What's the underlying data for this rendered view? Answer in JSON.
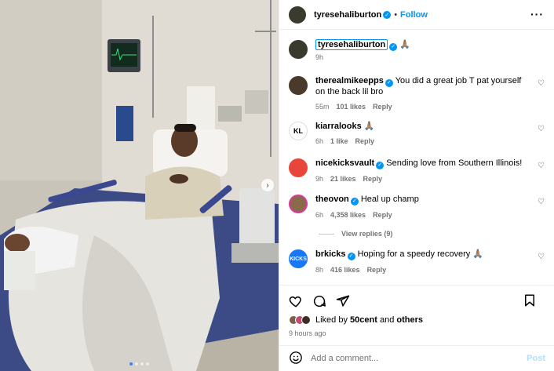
{
  "colors": {
    "accent": "#0095f6",
    "verified": "#0095f6",
    "muted": "#737373"
  },
  "post": {
    "author": "tyresehaliburton",
    "follow_label": "Follow",
    "separator": "•",
    "more_icon": "more-horizontal-icon",
    "photo_alt": "Man in hospital bed with leg in cast",
    "carousel": {
      "slides": 4,
      "active_index": 0
    }
  },
  "caption": {
    "username": "tyresehaliburton",
    "text": "🙏🏽",
    "time": "9h"
  },
  "comments": [
    {
      "username": "therealmikeepps",
      "verified": true,
      "text": "You did a great job T pat yourself on the back lil bro",
      "time": "55m",
      "likes": "101 likes",
      "reply": "Reply",
      "avatar_color": "#4a3a2c",
      "avatar_text": ""
    },
    {
      "username": "kiarralooks",
      "verified": false,
      "text": "🙏🏽",
      "time": "6h",
      "likes": "1 like",
      "reply": "Reply",
      "avatar_color": "#ffffff",
      "avatar_text": "KL"
    },
    {
      "username": "nicekicksvault",
      "verified": true,
      "text": "Sending love from Southern Illinois!",
      "time": "9h",
      "likes": "21 likes",
      "reply": "Reply",
      "avatar_color": "#e8463a",
      "avatar_text": ""
    },
    {
      "username": "theovon",
      "verified": true,
      "text": "Heal up champ",
      "time": "6h",
      "likes": "4,358 likes",
      "reply": "Reply",
      "avatar_color": "#8a6a4a",
      "avatar_text": ""
    },
    {
      "username": "brkicks",
      "verified": true,
      "text": "Hoping for a speedy recovery 🙏🏽",
      "time": "8h",
      "likes": "416 likes",
      "reply": "Reply",
      "avatar_color": "#1877f2",
      "avatar_text": "KICKS"
    }
  ],
  "view_replies": "View replies (9)",
  "likes": {
    "prefix": "Liked by",
    "user": "50cent",
    "and": "and",
    "others": "others"
  },
  "timestamp": "9 hours ago",
  "add_comment": {
    "placeholder": "Add a comment...",
    "post_label": "Post"
  }
}
